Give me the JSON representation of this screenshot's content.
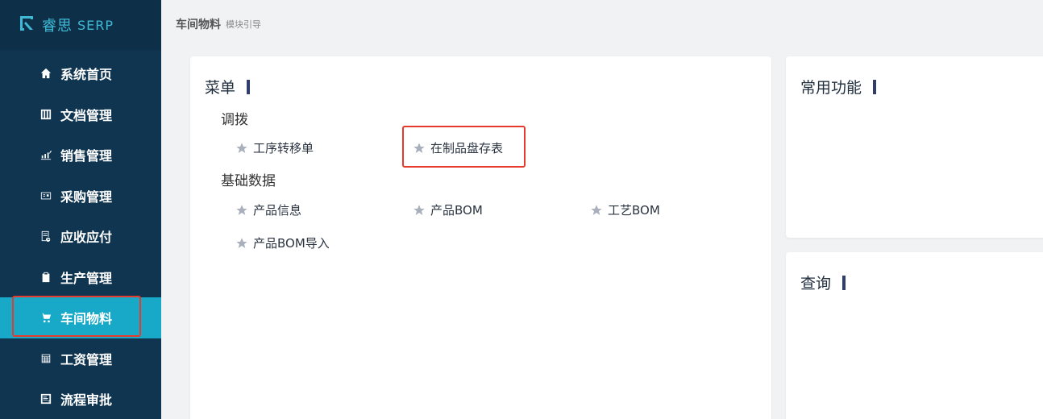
{
  "app": {
    "logo_cn": "睿思",
    "logo_en": "SERP"
  },
  "sidebar": {
    "items": [
      {
        "label": "系统首页",
        "icon": "home-icon"
      },
      {
        "label": "文档管理",
        "icon": "document-icon"
      },
      {
        "label": "销售管理",
        "icon": "sales-chart-icon"
      },
      {
        "label": "采购管理",
        "icon": "purchase-icon"
      },
      {
        "label": "应收应付",
        "icon": "ledger-icon"
      },
      {
        "label": "生产管理",
        "icon": "clipboard-icon"
      },
      {
        "label": "车间物料",
        "icon": "cart-icon",
        "active": true
      },
      {
        "label": "工资管理",
        "icon": "calculator-icon"
      },
      {
        "label": "流程审批",
        "icon": "approval-icon"
      }
    ]
  },
  "header": {
    "title": "车间物料",
    "subtitle": "模块引导"
  },
  "menu_card": {
    "title": "菜单",
    "groups": [
      {
        "label": "调拨",
        "items": [
          "工序转移单",
          "在制品盘存表"
        ]
      },
      {
        "label": "基础数据",
        "items": [
          "产品信息",
          "产品BOM",
          "工艺BOM",
          "产品BOM导入"
        ]
      }
    ]
  },
  "fav_card": {
    "title": "常用功能"
  },
  "query_card": {
    "title": "查询"
  },
  "colors": {
    "sidebar_bg": "#0f3550",
    "active_bg": "#17a9c7",
    "highlight": "#e53a2c",
    "accent": "#3fb9d5"
  }
}
